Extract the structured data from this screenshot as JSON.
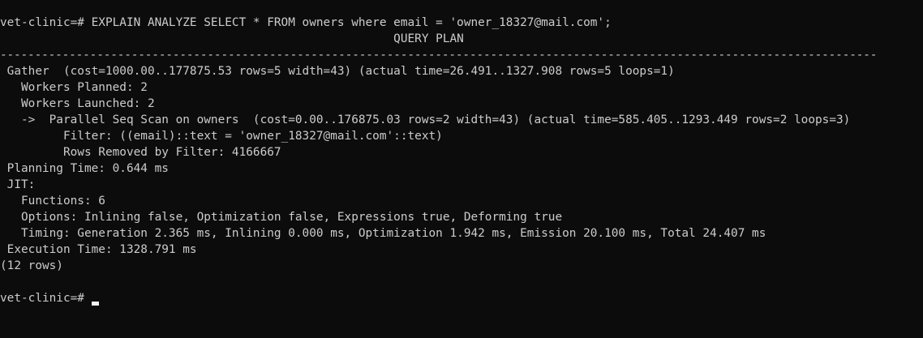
{
  "terminal": {
    "command_line": "vet-clinic=# EXPLAIN ANALYZE SELECT * FROM owners where email = 'owner_18327@mail.com';",
    "header": "                                                        QUERY PLAN",
    "separator": "-------------------------------------------------------------------------------------------------------------------------------",
    "plan_lines": [
      " Gather  (cost=1000.00..177875.53 rows=5 width=43) (actual time=26.491..1327.908 rows=5 loops=1)",
      "   Workers Planned: 2",
      "   Workers Launched: 2",
      "   ->  Parallel Seq Scan on owners  (cost=0.00..176875.03 rows=2 width=43) (actual time=585.405..1293.449 rows=2 loops=3)",
      "         Filter: ((email)::text = 'owner_18327@mail.com'::text)",
      "         Rows Removed by Filter: 4166667",
      " Planning Time: 0.644 ms",
      " JIT:",
      "   Functions: 6",
      "   Options: Inlining false, Optimization false, Expressions true, Deforming true",
      "   Timing: Generation 2.365 ms, Inlining 0.000 ms, Optimization 1.942 ms, Emission 20.100 ms, Total 24.407 ms",
      " Execution Time: 1328.791 ms"
    ],
    "row_count": "(12 rows)",
    "blank": "",
    "prompt": "vet-clinic=# "
  }
}
